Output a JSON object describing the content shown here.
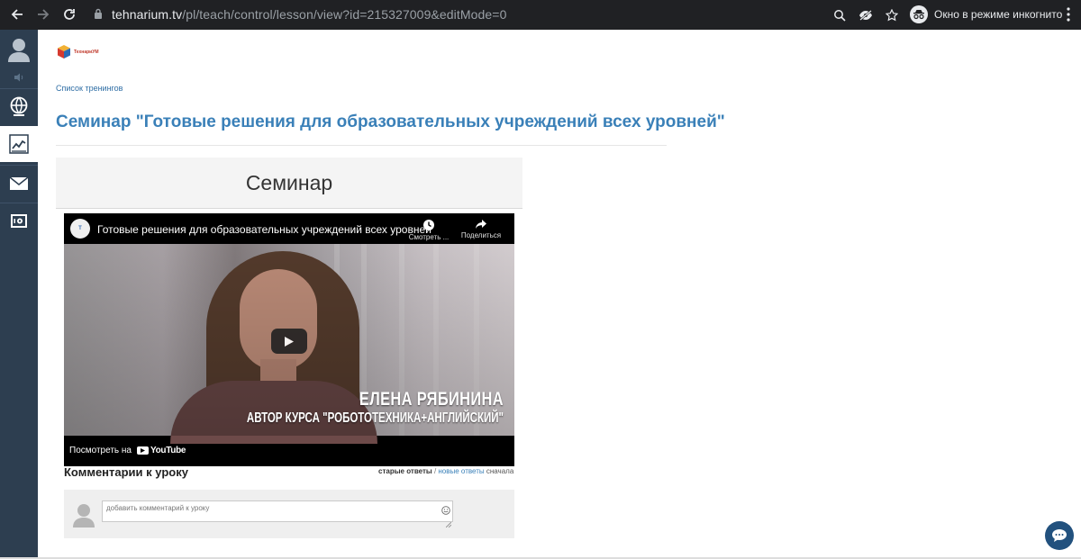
{
  "browser": {
    "url_host": "tehnarium.tv",
    "url_path": "/pl/teach/control/lesson/view?id=215327009&editMode=0",
    "incognito_label": "Окно в режиме инкогнито"
  },
  "sidebar": {
    "items": [
      {
        "icon": "user-icon"
      },
      {
        "icon": "speaker-icon"
      },
      {
        "icon": "globe-icon"
      },
      {
        "icon": "chart-icon",
        "active": true
      },
      {
        "icon": "mail-icon"
      },
      {
        "icon": "safe-icon"
      }
    ]
  },
  "logo": {
    "text": "ТехнариУМ"
  },
  "breadcrumb": {
    "label": "Список тренингов"
  },
  "page": {
    "title": "Семинар \"Готовые решения для образовательных учреждений всех уровней\"",
    "lesson_header": "Семинар"
  },
  "video": {
    "title": "Готовые решения для образовательных учреждений всех уровней",
    "watch_later_label": "Смотреть ...",
    "share_label": "Поделиться",
    "overlay_name": "ЕЛЕНА РЯБИНИНА",
    "overlay_role": "АВТОР КУРСА \"РОБОТОТЕХНИКА+АНГЛИЙСКИЙ\"",
    "watch_on_label": "Посмотреть на",
    "youtube_label": "YouTube"
  },
  "comments": {
    "title": "Комментарии к уроку",
    "sort_old": "старые ответы",
    "sort_separator": " / ",
    "sort_new": "новые ответы",
    "sort_first": " сначала",
    "input_placeholder": "добавить комментарий к уроку"
  },
  "colors": {
    "sidebar_bg": "#2d3e50",
    "title_blue": "#3a80b8",
    "link_blue": "#2e6da4",
    "chat_fab": "#22517e"
  }
}
